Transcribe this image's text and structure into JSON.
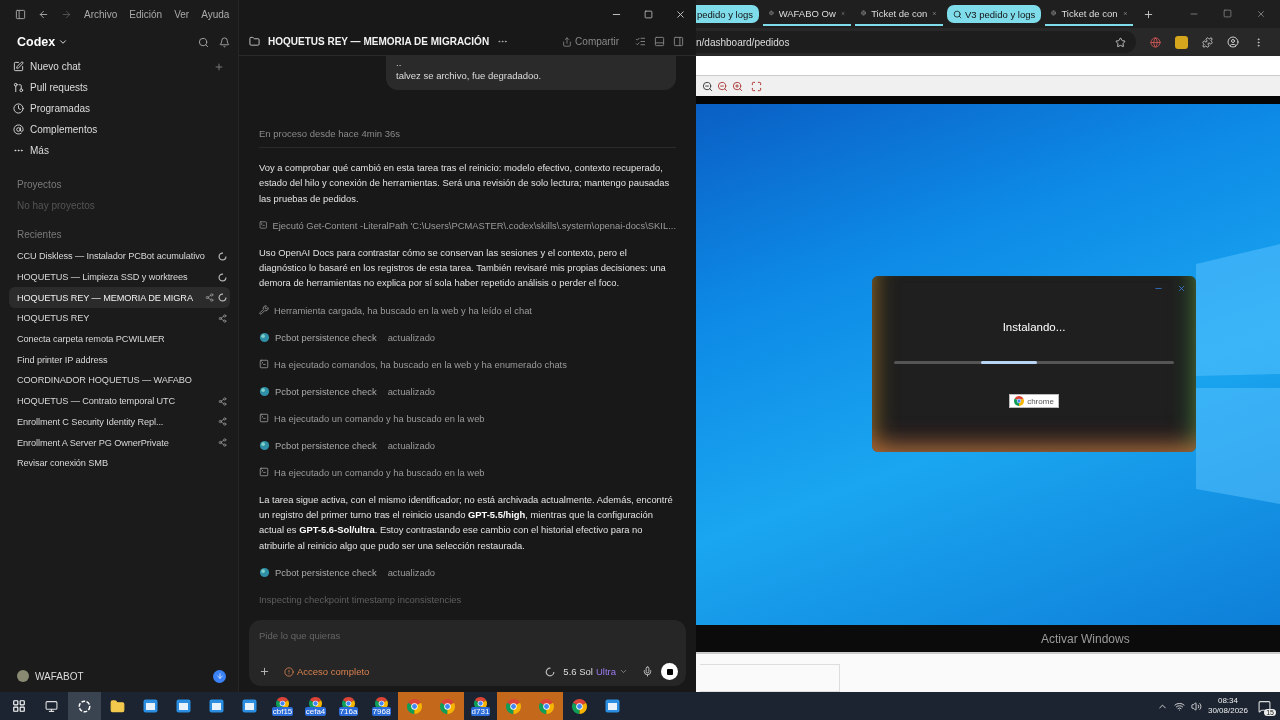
{
  "codex": {
    "menu": [
      "Archivo",
      "Edición",
      "Ver",
      "Ayuda"
    ],
    "sidebar": {
      "title": "Codex",
      "nav": [
        {
          "label": "Nuevo chat",
          "kind": "new"
        },
        {
          "label": "Pull requests",
          "kind": "pulls"
        },
        {
          "label": "Programadas",
          "kind": "scheduled"
        },
        {
          "label": "Complementos",
          "kind": "plugins"
        },
        {
          "label": "Más",
          "kind": "more"
        }
      ],
      "projects_heading": "Proyectos",
      "projects_empty": "No hay proyectos",
      "recents_heading": "Recientes",
      "recents": [
        {
          "label": "CCU Diskless — Instalador PCBot acumulativo",
          "selected": false,
          "running": true,
          "shared": false
        },
        {
          "label": "HOQUETUS — Limpieza SSD y worktrees",
          "selected": false,
          "running": true,
          "shared": false
        },
        {
          "label": "HOQUETUS REY — MEMORIA DE MIGRA",
          "selected": true,
          "running": true,
          "shared": true
        },
        {
          "label": "HOQUETUS REY",
          "selected": false,
          "running": false,
          "shared": true
        },
        {
          "label": "Conecta carpeta remota PCWILMER",
          "selected": false,
          "running": false,
          "shared": false
        },
        {
          "label": "Find printer IP address",
          "selected": false,
          "running": false,
          "shared": false
        },
        {
          "label": "COORDINADOR HOQUETUS — WAFABO",
          "selected": false,
          "running": false,
          "shared": false
        },
        {
          "label": "HOQUETUS — Contrato temporal UTC",
          "selected": false,
          "running": false,
          "shared": true
        },
        {
          "label": "Enrollment C Security Identity Repl...",
          "selected": false,
          "running": false,
          "shared": true
        },
        {
          "label": "Enrollment A Server PG OwnerPrivate",
          "selected": false,
          "running": false,
          "shared": true
        },
        {
          "label": "Revisar conexión SMB",
          "selected": false,
          "running": false,
          "shared": false
        }
      ],
      "user": "WAFABOT"
    },
    "chat": {
      "title": "HOQUETUS REY — MEMORIA DE MIGRACIÓN",
      "share": "Compartir",
      "user_message": [
        "..",
        "talvez se archivo, fue degradadoo."
      ],
      "status": "En proceso desde hace 4min 36s",
      "items": [
        {
          "kind": "text",
          "text": "Voy a comprobar qué cambió en esta tarea tras el reinicio: modelo efectivo, contexto recuperado, estado del hilo y conexión de herramientas. Será una revisión de solo lectura; mantengo pausadas las pruebas de pedidos."
        },
        {
          "kind": "command",
          "text": "Ejecutó Get-Content -LiteralPath 'C:\\Users\\PCMASTER\\.codex\\skills\\.system\\openai-docs\\SKIL..."
        },
        {
          "kind": "text",
          "text": "Uso OpenAI Docs para contrastar cómo se conservan las sesiones y el contexto, pero el diagnóstico lo basaré en los registros de esta tarea. También revisaré mis propias decisiones: una demora de herramientas no explica por sí sola haber repetido análisis o perder el foco."
        },
        {
          "kind": "tool",
          "text": "Herramienta cargada, ha buscado en la web y ha leído el chat"
        },
        {
          "kind": "plugin",
          "text": "Pcbot persistence check",
          "badge": "actualizado"
        },
        {
          "kind": "command",
          "text": "Ha ejecutado comandos, ha buscado en la web y ha enumerado chats"
        },
        {
          "kind": "plugin",
          "text": "Pcbot persistence check",
          "badge": "actualizado"
        },
        {
          "kind": "command",
          "text": "Ha ejecutado un comando y ha buscado en la web"
        },
        {
          "kind": "plugin",
          "text": "Pcbot persistence check",
          "badge": "actualizado"
        },
        {
          "kind": "command",
          "text": "Ha ejecutado un comando y ha buscado en la web"
        },
        {
          "kind": "text",
          "text": "La tarea sigue activa, con el mismo identificador; no está archivada actualmente. Además, encontré un registro del primer turno tras el reinicio usando **GPT-5.5/high**, mientras que la configuración actual es **GPT-5.6-Sol/ultra**. Estoy contrastando ese cambio con el historial efectivo para no atribuirle al reinicio algo que pudo ser una selección restaurada."
        },
        {
          "kind": "plugin",
          "text": "Pcbot persistence check",
          "badge": "actualizado"
        }
      ],
      "thinking": "Inspecting checkpoint timestamp inconsistencies",
      "composer": {
        "placeholder": "Pide lo que quieras",
        "access": "Acceso completo",
        "model": "5.6 Sol",
        "effort": "Ultra"
      }
    }
  },
  "browser": {
    "tabs": [
      {
        "kind": "group",
        "label": "pedido y logs"
      },
      {
        "kind": "tab",
        "label": "WAFABO Ow"
      },
      {
        "kind": "tab",
        "label": "Ticket de con"
      },
      {
        "kind": "group",
        "label": "V3 pedido y logs"
      },
      {
        "kind": "tab",
        "label": "Ticket de con"
      }
    ],
    "url": "n/dashboard/pedidos",
    "installer": {
      "title": "Instalando...",
      "badge": "chrome"
    },
    "notice": "Activar Windows"
  },
  "taskbar": {
    "buttons": [
      {
        "kind": "start",
        "active": false,
        "flashing": false
      },
      {
        "kind": "taskview",
        "active": false,
        "flashing": false
      },
      {
        "kind": "chatgpt",
        "active": true,
        "flashing": false
      },
      {
        "kind": "explorer",
        "active": false,
        "flashing": false
      },
      {
        "kind": "app",
        "active": false,
        "flashing": false
      },
      {
        "kind": "app",
        "active": false,
        "flashing": false
      },
      {
        "kind": "app",
        "active": false,
        "flashing": false
      },
      {
        "kind": "app",
        "active": false,
        "flashing": false
      },
      {
        "kind": "labeled",
        "label": "cbf15",
        "active": false,
        "flashing": false
      },
      {
        "kind": "labeled",
        "label": "cefa4",
        "active": false,
        "flashing": false
      },
      {
        "kind": "labeled",
        "label": "716a",
        "active": false,
        "flashing": false
      },
      {
        "kind": "labeled",
        "label": "7968",
        "active": false,
        "flashing": false
      },
      {
        "kind": "chrome",
        "active": false,
        "flashing": true
      },
      {
        "kind": "chrome",
        "active": false,
        "flashing": true
      },
      {
        "kind": "labeled",
        "label": "d731",
        "active": false,
        "flashing": false
      },
      {
        "kind": "chrome",
        "active": false,
        "flashing": true
      },
      {
        "kind": "chrome",
        "active": false,
        "flashing": true
      },
      {
        "kind": "chrome",
        "active": false,
        "flashing": false
      },
      {
        "kind": "app",
        "active": false,
        "flashing": false
      }
    ],
    "time": "08:34",
    "date": "30/08/2026",
    "notifications": "15"
  }
}
